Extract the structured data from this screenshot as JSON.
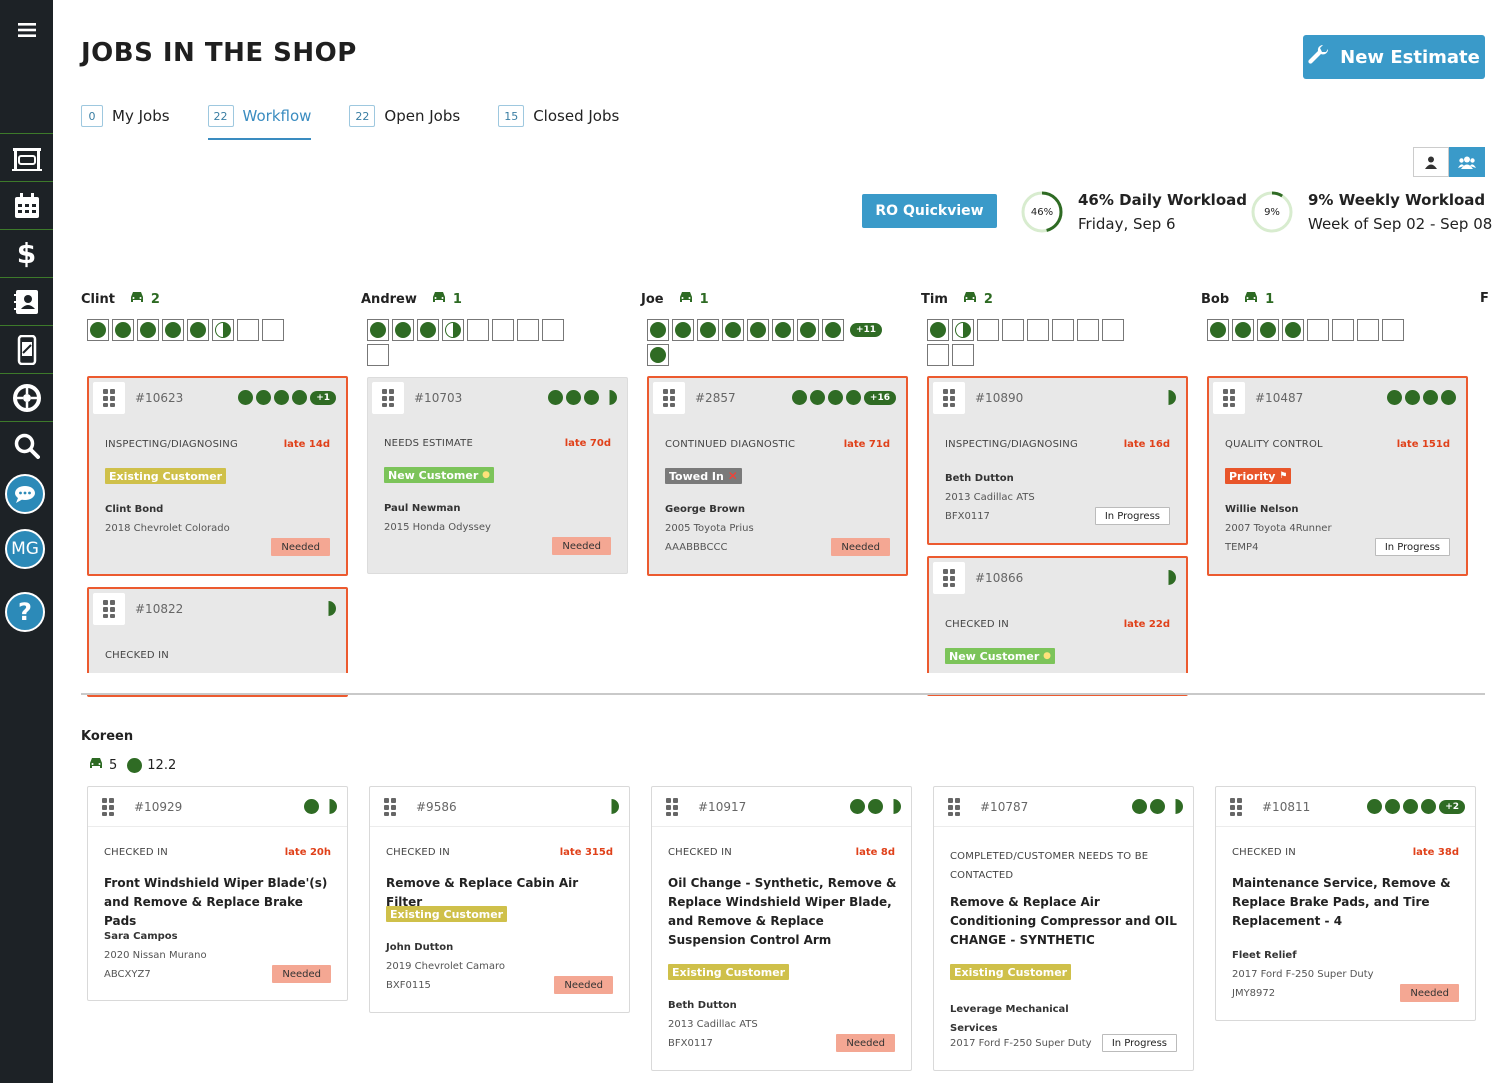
{
  "app": {
    "title": "JOBS IN THE SHOP",
    "new_estimate_label": "New Estimate",
    "user_initials": "MG"
  },
  "tabs": [
    {
      "count": "0",
      "label": "My Jobs"
    },
    {
      "count": "22",
      "label": "Workflow",
      "active": true
    },
    {
      "count": "22",
      "label": "Open Jobs"
    },
    {
      "count": "15",
      "label": "Closed Jobs"
    }
  ],
  "workload": {
    "ro_quickview_label": "RO Quickview",
    "daily": {
      "percent_label": "46%",
      "percent": 46,
      "title": "46% Daily Workload",
      "subtitle": "Friday, Sep 6"
    },
    "weekly": {
      "percent_label": "9%",
      "percent": 9,
      "title": "9% Weekly Workload",
      "subtitle": "Week of Sep 02 - Sep 08"
    }
  },
  "colors": {
    "accent": "#3a9ac9",
    "late_border": "#ec5a2f",
    "green": "#2f6b24",
    "needed": "#f4a793"
  },
  "techs": [
    {
      "name": "Clint",
      "cars": "2",
      "cards": [
        {
          "num": "#10623",
          "dots": 4,
          "half": false,
          "plus": "+1",
          "status": "INSPECTING/DIAGNOSING",
          "late": "late 14d",
          "badge": "Existing Customer",
          "customer": "Clint Bond",
          "vehicle": "2018 Chevrolet Colorado",
          "plate": "",
          "tag": "Needed"
        },
        {
          "num": "#10822",
          "dots": 0,
          "half": true,
          "plus": "",
          "status": "CHECKED IN",
          "late": ""
        }
      ]
    },
    {
      "name": "Andrew",
      "cars": "1",
      "cards": [
        {
          "num": "#10703",
          "dots": 3,
          "half": true,
          "plus": "",
          "status": "NEEDS ESTIMATE",
          "late": "late 70d",
          "badge": "New Customer",
          "customer": "Paul Newman",
          "vehicle": "2015 Honda Odyssey",
          "plate": "",
          "tag": "Needed"
        }
      ]
    },
    {
      "name": "Joe",
      "cars": "1",
      "slot_plus": "+11",
      "cards": [
        {
          "num": "#2857",
          "dots": 4,
          "half": false,
          "plus": "+16",
          "status": "CONTINUED DIAGNOSTIC",
          "late": "late 71d",
          "badge": "Towed In",
          "customer": "George Brown",
          "vehicle": "2005 Toyota Prius",
          "plate": "AAABBBCCC",
          "tag": "Needed"
        }
      ]
    },
    {
      "name": "Tim",
      "cars": "2",
      "cards": [
        {
          "num": "#10890",
          "dots": 0,
          "half": true,
          "plus": "",
          "status": "INSPECTING/DIAGNOSING",
          "late": "late 16d",
          "customer": "Beth Dutton",
          "vehicle": "2013 Cadillac ATS",
          "plate": "BFX0117",
          "tag": "In Progress"
        },
        {
          "num": "#10866",
          "dots": 0,
          "half": true,
          "plus": "",
          "status": "CHECKED IN",
          "late": "late 22d",
          "badge": "New Customer"
        }
      ]
    },
    {
      "name": "Bob",
      "cars": "1",
      "cards": [
        {
          "num": "#10487",
          "dots": 4,
          "half": false,
          "plus": "",
          "status": "QUALITY CONTROL",
          "late": "late 151d",
          "badge": "Priority",
          "customer": "Willie Nelson",
          "vehicle": "2007 Toyota 4Runner",
          "plate": "TEMP4",
          "tag": "In Progress"
        }
      ]
    },
    {
      "name": "F"
    }
  ],
  "unassigned": {
    "name": "Koreen",
    "cars": "5",
    "hours": "12.2",
    "cards": [
      {
        "num": "#10929",
        "status": "CHECKED IN",
        "late": "late 20h",
        "title": "Front Windshield Wiper Blade'(s) and Remove & Replace Brake Pads",
        "customer": "Sara Campos",
        "vehicle": "2020 Nissan Murano",
        "plate": "ABCXYZ7",
        "tag": "Needed"
      },
      {
        "num": "#9586",
        "status": "CHECKED IN",
        "late": "late 315d",
        "title": "Remove & Replace Cabin Air Filter",
        "badge": "Existing Customer",
        "customer": "John Dutton",
        "vehicle": "2019 Chevrolet Camaro",
        "plate": "BXF0115",
        "tag": "Needed"
      },
      {
        "num": "#10917",
        "status": "CHECKED IN",
        "late": "late 8d",
        "title": "Oil Change - Synthetic, Remove & Replace Windshield Wiper Blade, and Remove & Replace Suspension Control Arm",
        "badge": "Existing Customer",
        "customer": "Beth Dutton",
        "vehicle": "2013 Cadillac ATS",
        "plate": "BFX0117",
        "tag": "Needed"
      },
      {
        "num": "#10787",
        "status": "COMPLETED/CUSTOMER NEEDS TO BE CONTACTED",
        "late": "",
        "title": "Remove & Replace Air Conditioning Compressor and OIL CHANGE - SYNTHETIC",
        "badge": "Existing Customer",
        "customer": "Leverage Mechanical Services",
        "vehicle": "2017 Ford F-250 Super Duty",
        "plate": "",
        "tag": "In Progress"
      },
      {
        "num": "#10811",
        "plus": "+2",
        "status": "CHECKED IN",
        "late": "late 38d",
        "title": "Maintenance Service, Remove & Replace Brake Pads, and Tire Replacement - 4",
        "customer": "Fleet Relief",
        "vehicle": "2017 Ford F-250 Super Duty",
        "plate": "JMY8972",
        "tag": "Needed"
      }
    ]
  }
}
